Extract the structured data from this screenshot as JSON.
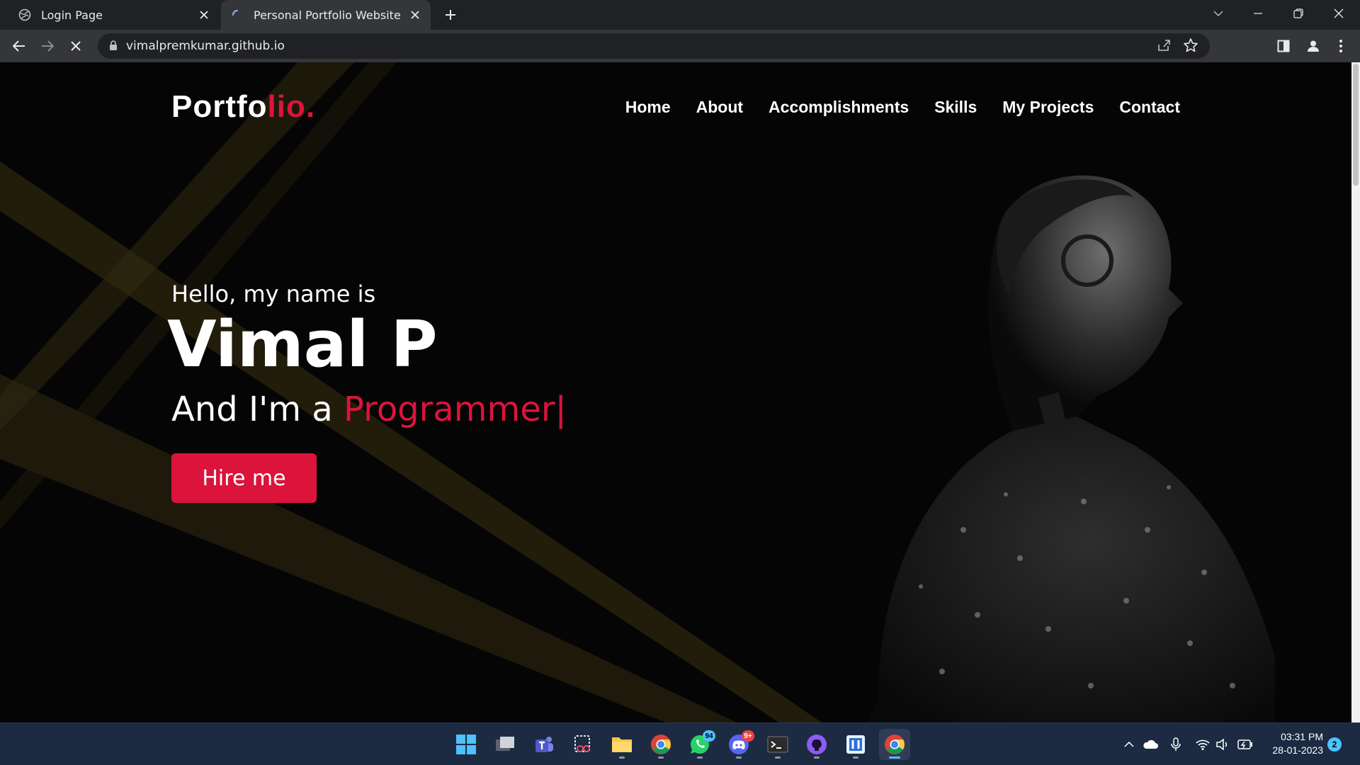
{
  "browser": {
    "tabs": [
      {
        "title": "Login Page",
        "active": false
      },
      {
        "title": "Personal Portfolio Website",
        "active": true
      }
    ],
    "url": "vimalpremkumar.github.io"
  },
  "site": {
    "logo_main": "Portfo",
    "logo_accent": "lio.",
    "nav": [
      "Home",
      "About",
      "Accomplishments",
      "Skills",
      "My Projects",
      "Contact"
    ],
    "greeting": "Hello, my name is",
    "name": "Vimal P",
    "role_prefix": "And I'm a ",
    "role_typed": "Programmer",
    "cursor": "|",
    "cta": "Hire me",
    "accent_color": "#dc143c"
  },
  "taskbar": {
    "badges": {
      "whatsapp": "94",
      "discord": "9+"
    },
    "time": "03:31 PM",
    "date": "28-01-2023",
    "notifications": "2"
  }
}
